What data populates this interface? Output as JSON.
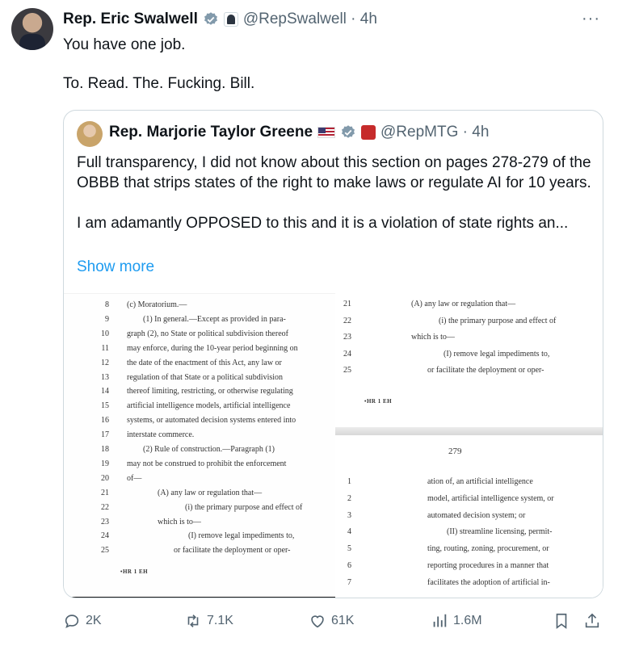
{
  "tweet": {
    "author_name": "Rep. Eric Swalwell",
    "handle_time": "@RepSwalwell · 4h",
    "text_line1": "You have one job.",
    "text_line2": "To. Read. The. Fucking. Bill.",
    "more_label": "···"
  },
  "quote": {
    "author_name": "Rep. Marjorie Taylor Greene",
    "handle_time": "@RepMTG · 4h",
    "para1": "Full transparency, I did not know about this section on pages 278-279 of the OBBB that strips states of the right to make laws or regulate AI for 10 years.",
    "para2": "I am adamantly OPPOSED to this and it is a violation of state rights an...",
    "show_more": "Show more"
  },
  "doc_left": {
    "lines": [
      {
        "n": "8",
        "t": "(c) Moratorium.—"
      },
      {
        "n": "9",
        "t": "(1) In general.—Except as provided in para-"
      },
      {
        "n": "10",
        "t": "graph (2), no State or political subdivision thereof"
      },
      {
        "n": "11",
        "t": "may enforce, during the 10-year period beginning on"
      },
      {
        "n": "12",
        "t": "the date of the enactment of this Act, any law or"
      },
      {
        "n": "13",
        "t": "regulation of that State or a political subdivision"
      },
      {
        "n": "14",
        "t": "thereof limiting, restricting, or otherwise regulating"
      },
      {
        "n": "15",
        "t": "artificial intelligence models, artificial intelligence"
      },
      {
        "n": "16",
        "t": "systems, or automated decision systems entered into"
      },
      {
        "n": "17",
        "t": "interstate commerce."
      },
      {
        "n": "18",
        "t": "(2) Rule of construction.—Paragraph (1)"
      },
      {
        "n": "19",
        "t": "may not be construed to prohibit the enforcement"
      },
      {
        "n": "20",
        "t": "of—"
      },
      {
        "n": "21",
        "t": "(A) any law or regulation that—"
      },
      {
        "n": "22",
        "t": "(i) the primary purpose and effect of"
      },
      {
        "n": "23",
        "t": "which is to—"
      },
      {
        "n": "24",
        "t": "(I) remove legal impediments to,"
      },
      {
        "n": "25",
        "t": "or facilitate the deployment or oper-"
      }
    ],
    "footer": "•HR 1 EH"
  },
  "doc_right_top": {
    "lines": [
      {
        "n": "21",
        "t": "(A) any law or regulation that—"
      },
      {
        "n": "22",
        "t": "(i) the primary purpose and effect of"
      },
      {
        "n": "23",
        "t": "which is to—"
      },
      {
        "n": "24",
        "t": "(I) remove legal impediments to,"
      },
      {
        "n": "25",
        "t": "or facilitate the deployment or oper-"
      }
    ],
    "footer": "•HR 1 EH"
  },
  "doc_right_bottom": {
    "page_number": "279",
    "lines": [
      {
        "n": "1",
        "t": "ation of, an artificial intelligence"
      },
      {
        "n": "2",
        "t": "model, artificial intelligence system, or"
      },
      {
        "n": "3",
        "t": "automated decision system; or"
      },
      {
        "n": "4",
        "t": "(II) streamline licensing, permit-"
      },
      {
        "n": "5",
        "t": "ting, routing, zoning, procurement, or"
      },
      {
        "n": "6",
        "t": "reporting procedures in a manner that"
      },
      {
        "n": "7",
        "t": "facilitates the adoption of artificial in-"
      }
    ]
  },
  "actions": {
    "replies": "2K",
    "reposts": "7.1K",
    "likes": "61K",
    "views": "1.6M"
  }
}
